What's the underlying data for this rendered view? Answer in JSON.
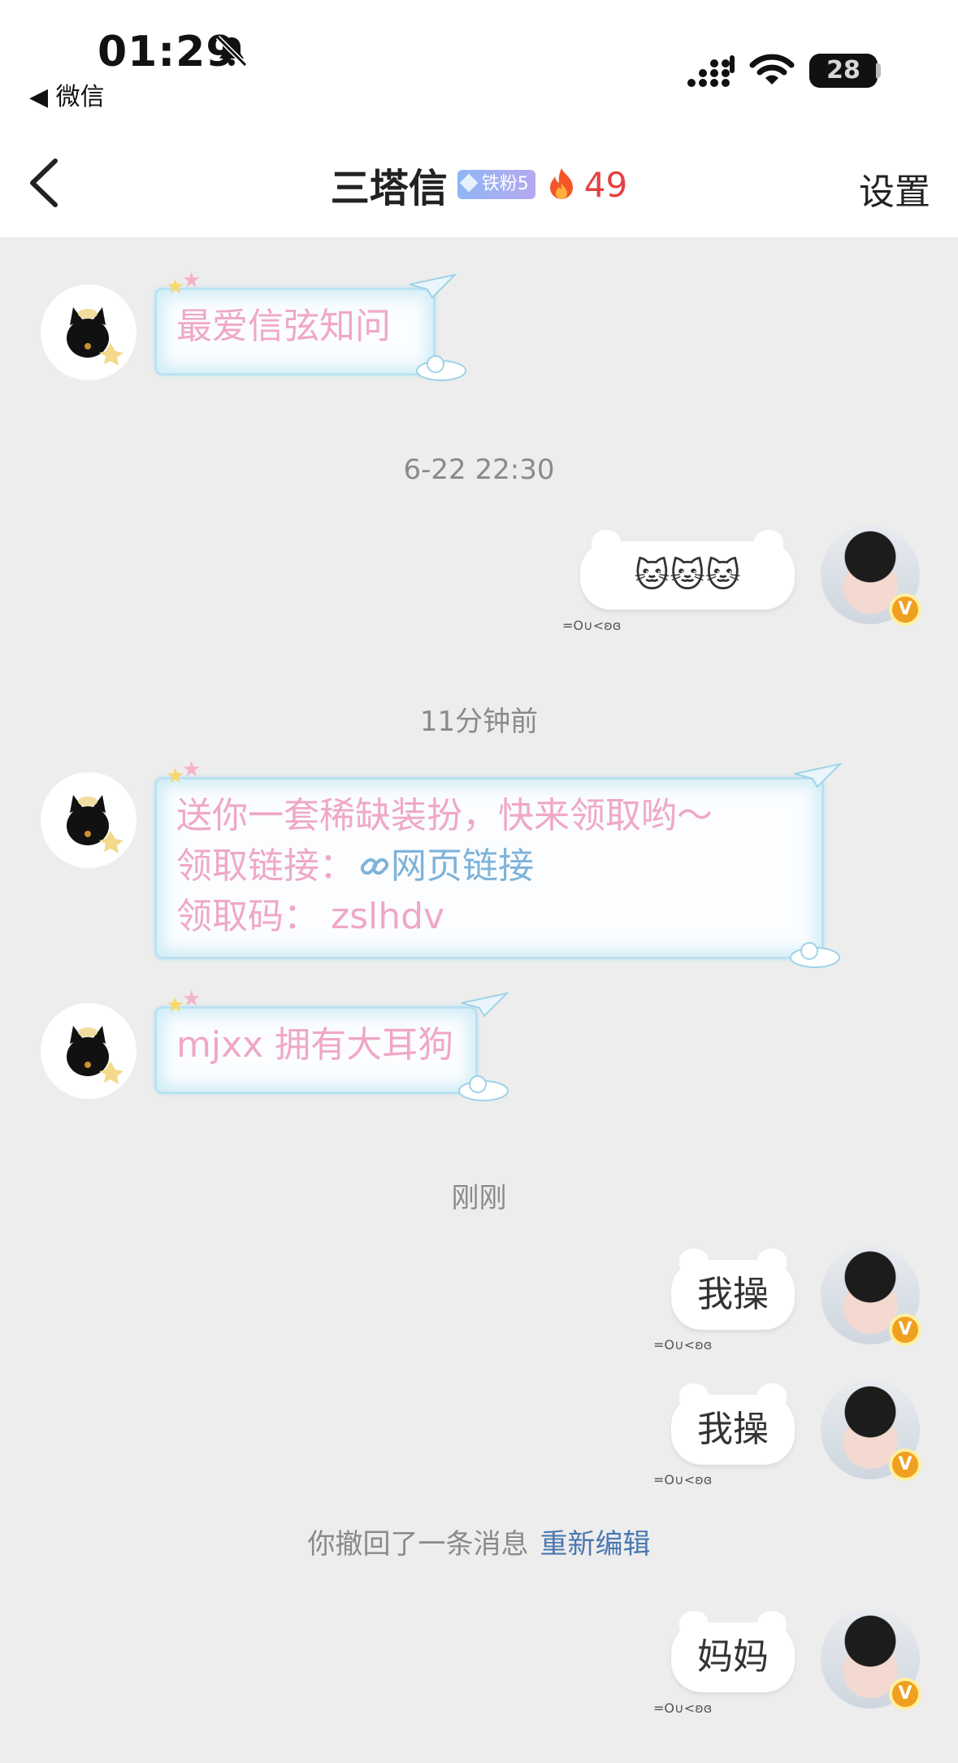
{
  "status_bar": {
    "time": "01:29",
    "back_app": "◀ 微信",
    "battery": "28"
  },
  "header": {
    "title": "三塔信",
    "fan_badge": "铁粉5",
    "streak": "49",
    "settings": "设置"
  },
  "messages": {
    "m1": {
      "text": "最爱信弦知问"
    },
    "ts1": "6-22 22:30",
    "m2": {
      "text": "🐱🐱🐱",
      "kaomoji": "=O∪<ʚɞ"
    },
    "ts2": "11分钟前",
    "m3": {
      "line1": "送你一套稀缺装扮，快来领取哟～",
      "line2_label": "领取链接：",
      "line2_link": "网页链接",
      "line3": "领取码：  zslhdv"
    },
    "m4": {
      "text": "mjxx 拥有大耳狗"
    },
    "ts3": "刚刚",
    "m5": {
      "text": "我操",
      "kaomoji": "=O∪<ʚɞ"
    },
    "m6": {
      "text": "我操",
      "kaomoji": "=O∪<ʚɞ"
    },
    "recall": {
      "text": "你撤回了一条消息",
      "action": "重新编辑"
    },
    "m7": {
      "text": "妈妈",
      "kaomoji": "=O∪<ʚɞ"
    }
  },
  "icons": {
    "back": "chevron-left-icon",
    "mute": "bell-slash-icon",
    "signal": "signal-icon",
    "wifi": "wifi-icon",
    "fire": "fire-icon",
    "link": "link-icon",
    "verified": "verified-v-icon"
  },
  "colors": {
    "incoming_text": "#f0a8c4",
    "link": "#7fb3d9",
    "streak": "#e64040",
    "re_edit": "#4a78b0"
  }
}
